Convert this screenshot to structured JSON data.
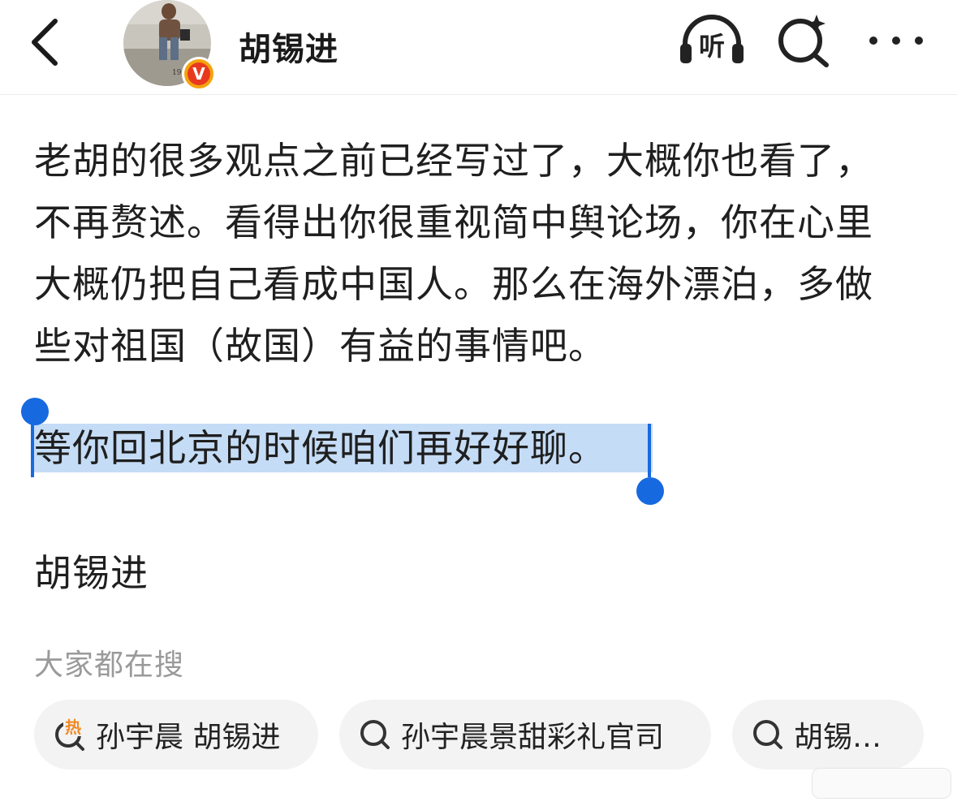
{
  "header": {
    "title": "胡锡进",
    "avatar_caption": "19",
    "verified_badge": "V",
    "listen_label": "听"
  },
  "post": {
    "paragraph": "老胡的很多观点之前已经写过了，大概你也看了，不再赘述。看得出你很重视简中舆论场，你在心里大概仍把自己看成中国人。那么在海外漂泊，多做些对祖国（故国）有益的事情吧。",
    "selected_text": "等你回北京的时候咱们再好好聊。",
    "signature": "胡锡进"
  },
  "trending": {
    "label": "大家都在搜",
    "chips": [
      {
        "text": "孙宇晨 胡锡进",
        "icon": "hot-search-icon",
        "badge": "热"
      },
      {
        "text": "孙宇晨景甜彩礼官司",
        "icon": "search-icon"
      },
      {
        "text": "胡锡…",
        "icon": "search-icon"
      }
    ]
  },
  "colors": {
    "selection_bg": "#c5dcf6",
    "selection_handle": "#1769e0",
    "verified_orange": "#f4a30d",
    "hot_orange": "#f08a24"
  }
}
